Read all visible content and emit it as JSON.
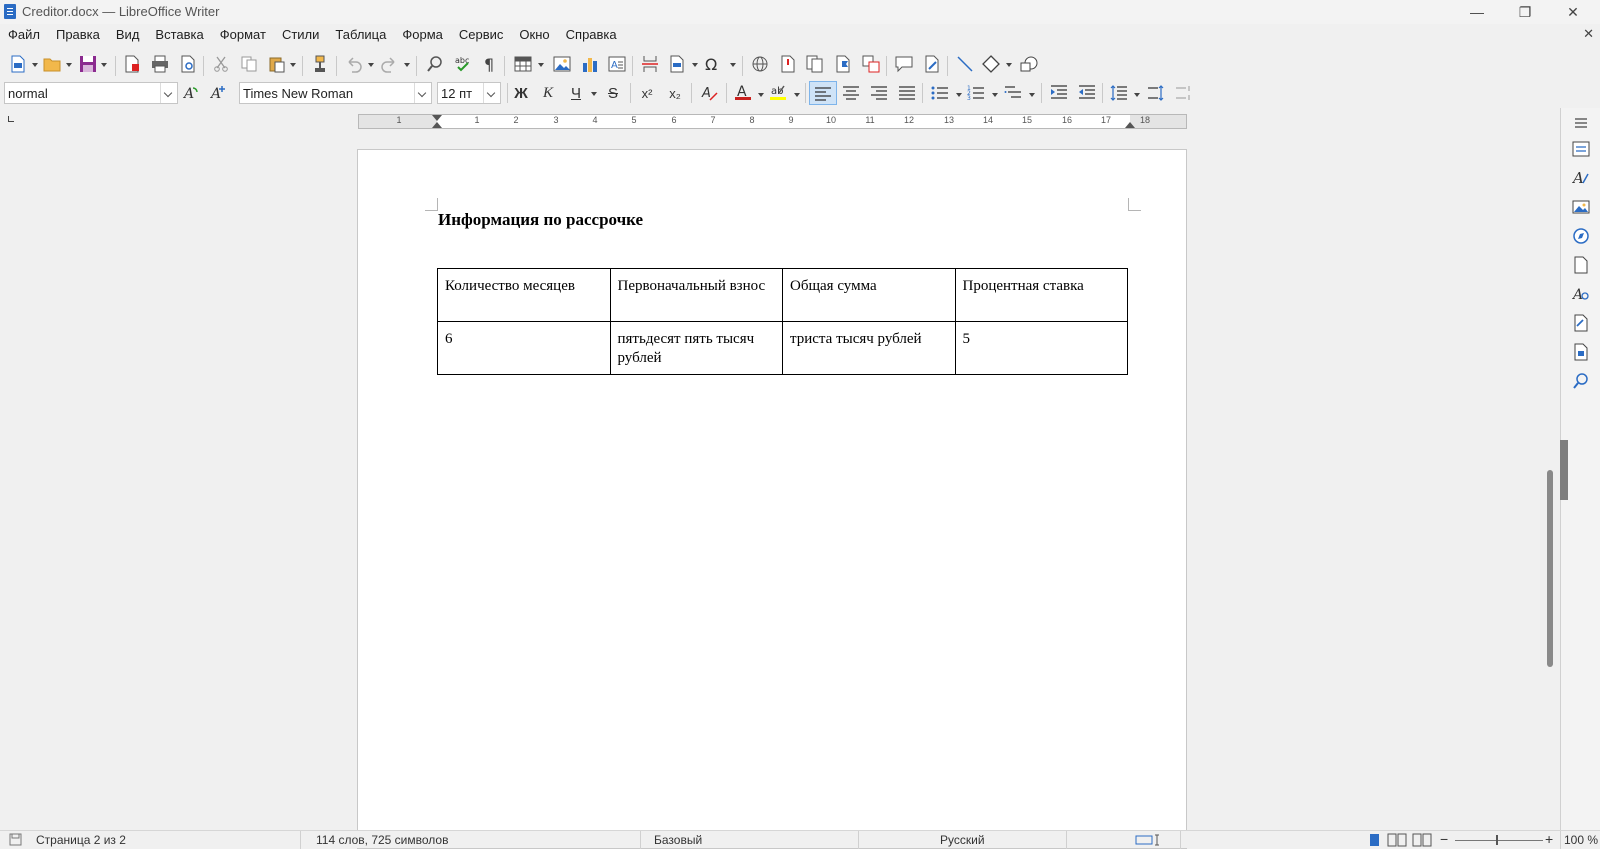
{
  "window": {
    "title": "Creditor.docx — LibreOffice Writer",
    "minimize": "—",
    "maximize": "❐",
    "close": "✕"
  },
  "menu": {
    "items": [
      "Файл",
      "Правка",
      "Вид",
      "Вставка",
      "Формат",
      "Стили",
      "Таблица",
      "Форма",
      "Сервис",
      "Окно",
      "Справка"
    ],
    "close_doc": "✕"
  },
  "formatting": {
    "paragraph_style": "normal",
    "font_name": "Times New Roman",
    "font_size": "12 пт",
    "bold": "Ж",
    "italic": "К",
    "underline": "Ч",
    "strike": "S",
    "superscript": "x²",
    "subscript": "x₂",
    "font_color": "#c9211e",
    "highlight_color": "#ffff00"
  },
  "ruler": {
    "numbers": [
      "1",
      "1",
      "2",
      "3",
      "4",
      "5",
      "6",
      "7",
      "8",
      "9",
      "10",
      "11",
      "12",
      "13",
      "14",
      "15",
      "16",
      "17",
      "18"
    ]
  },
  "document": {
    "heading": "Информация по рассрочке",
    "table": {
      "header": [
        "Количество месяцев",
        "Первоначальный взнос",
        "Общая сумма",
        "Процентная ставка"
      ],
      "rows": [
        [
          "6",
          "пятьдесят пять тысяч рублей",
          "триста тысяч рублей",
          "5"
        ]
      ]
    }
  },
  "status": {
    "page": "Страница 2 из 2",
    "words": "114 слов, 725 символов",
    "page_style": "Базовый",
    "language": "Русский",
    "zoom": "100 %"
  },
  "icons": {
    "toolbar1": [
      "new-icon",
      "open-icon",
      "save-icon",
      "export-pdf-icon",
      "print-icon",
      "print-preview-icon",
      "cut-icon",
      "copy-icon",
      "paste-icon",
      "clone-formatting-icon",
      "undo-icon",
      "redo-icon",
      "find-replace-icon",
      "spellcheck-icon",
      "formatting-marks-icon",
      "insert-table-icon",
      "insert-image-icon",
      "insert-chart-icon",
      "insert-textbox-icon",
      "page-break-icon",
      "insert-field-icon",
      "special-character-icon",
      "hyperlink-icon",
      "footnote-icon",
      "endnote-icon",
      "bookmark-icon",
      "cross-reference-icon",
      "comment-icon",
      "track-changes-icon",
      "line-icon",
      "shapes-icon",
      "draw-functions-icon"
    ],
    "sidebar": [
      "sidebar-menu-icon",
      "properties-icon",
      "styles-icon",
      "gallery-icon",
      "navigator-icon",
      "page-icon",
      "style-inspector-icon",
      "manage-changes-icon",
      "design-icon",
      "find-icon"
    ]
  }
}
